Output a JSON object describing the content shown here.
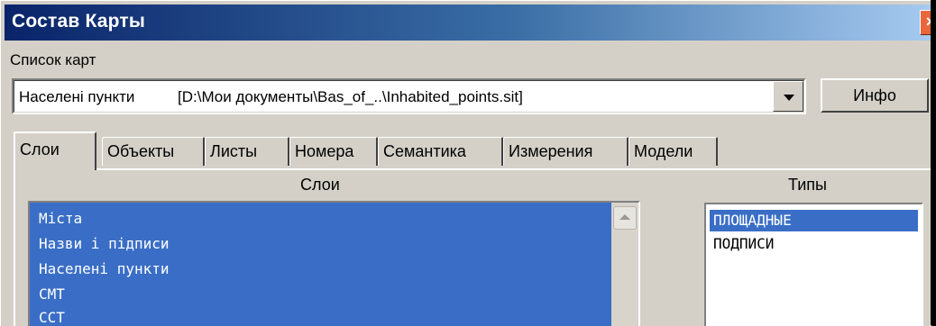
{
  "window": {
    "title": "Состав Карты",
    "close_label": "×"
  },
  "map_list": {
    "label": "Список карт",
    "selected_name": "Населені пункти",
    "selected_path": "[D:\\Мои документы\\Bas_of_..\\Inhabited_points.sit]",
    "info_button": "Инфо"
  },
  "tabs": [
    {
      "label": "Слои",
      "active": true
    },
    {
      "label": "Объекты",
      "active": false
    },
    {
      "label": "Листы",
      "active": false
    },
    {
      "label": "Номера",
      "active": false
    },
    {
      "label": "Семантика",
      "active": false
    },
    {
      "label": "Измерения",
      "active": false
    },
    {
      "label": "Модели",
      "active": false
    }
  ],
  "layers_panel": {
    "header": "Слои",
    "items": [
      "Міста",
      "Назви і підписи",
      "Населені пункти",
      "СМТ",
      "ССТ"
    ]
  },
  "types_panel": {
    "header": "Типы",
    "items": [
      "ПЛОЩАДНЫЕ",
      "ПОДПИСИ"
    ],
    "selected_index": 0
  },
  "colors": {
    "selection": "#3a6ec6",
    "title_bar_start": "#0a246a",
    "title_bar_end": "#a6caf0",
    "close_button": "#e8663b",
    "face": "#d4d0c8"
  }
}
